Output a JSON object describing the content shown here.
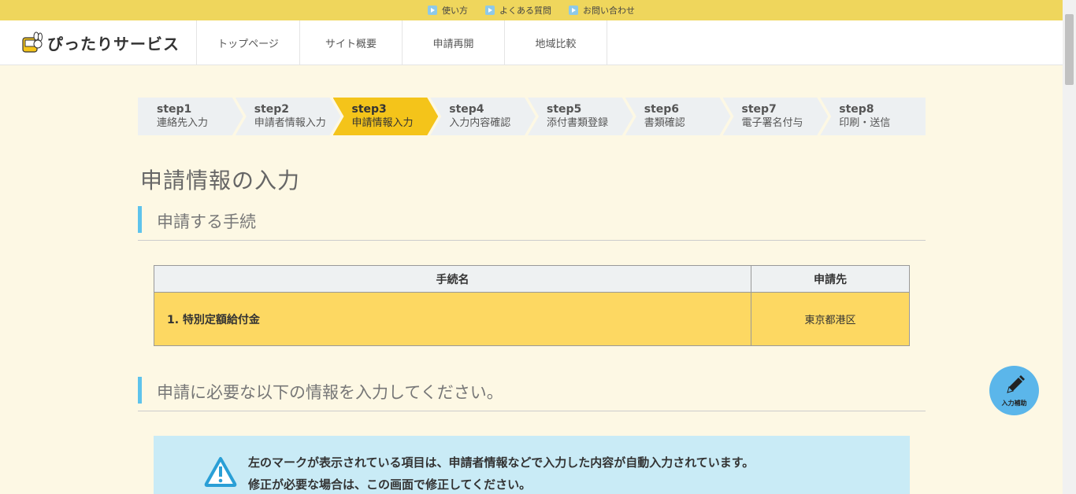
{
  "topbar": {
    "links": [
      "使い方",
      "よくある質問",
      "お問い合わせ"
    ]
  },
  "header": {
    "logo_text": "ぴったりサービス",
    "nav": [
      "トップページ",
      "サイト概要",
      "申請再開",
      "地域比較"
    ]
  },
  "steps": [
    {
      "num": "step1",
      "label": "連絡先入力"
    },
    {
      "num": "step2",
      "label": "申請者情報入力"
    },
    {
      "num": "step3",
      "label": "申請情報入力"
    },
    {
      "num": "step4",
      "label": "入力内容確認"
    },
    {
      "num": "step5",
      "label": "添付書類登録"
    },
    {
      "num": "step6",
      "label": "書類確認"
    },
    {
      "num": "step7",
      "label": "電子署名付与"
    },
    {
      "num": "step8",
      "label": "印刷・送信"
    }
  ],
  "page_title": "申請情報の入力",
  "section1": "申請する手続",
  "table": {
    "headers": [
      "手続名",
      "申請先"
    ],
    "rows": [
      {
        "name": "1. 特別定額給付金",
        "dest": "東京都港区"
      }
    ]
  },
  "section2": "申請に必要な以下の情報を入力してください。",
  "notice": {
    "line1": "左のマークが表示されている項目は、申請者情報などで入力した内容が自動入力されています。",
    "line2": "修正が必要な場合は、この画面で修正してください。"
  },
  "helper_label": "入力補助",
  "colors": {
    "topbar": "#efd65c",
    "active_step": "#f4c41a",
    "table_row": "#fdd862",
    "accent": "#5ec3ec",
    "notice_bg": "#c9ebf6"
  }
}
